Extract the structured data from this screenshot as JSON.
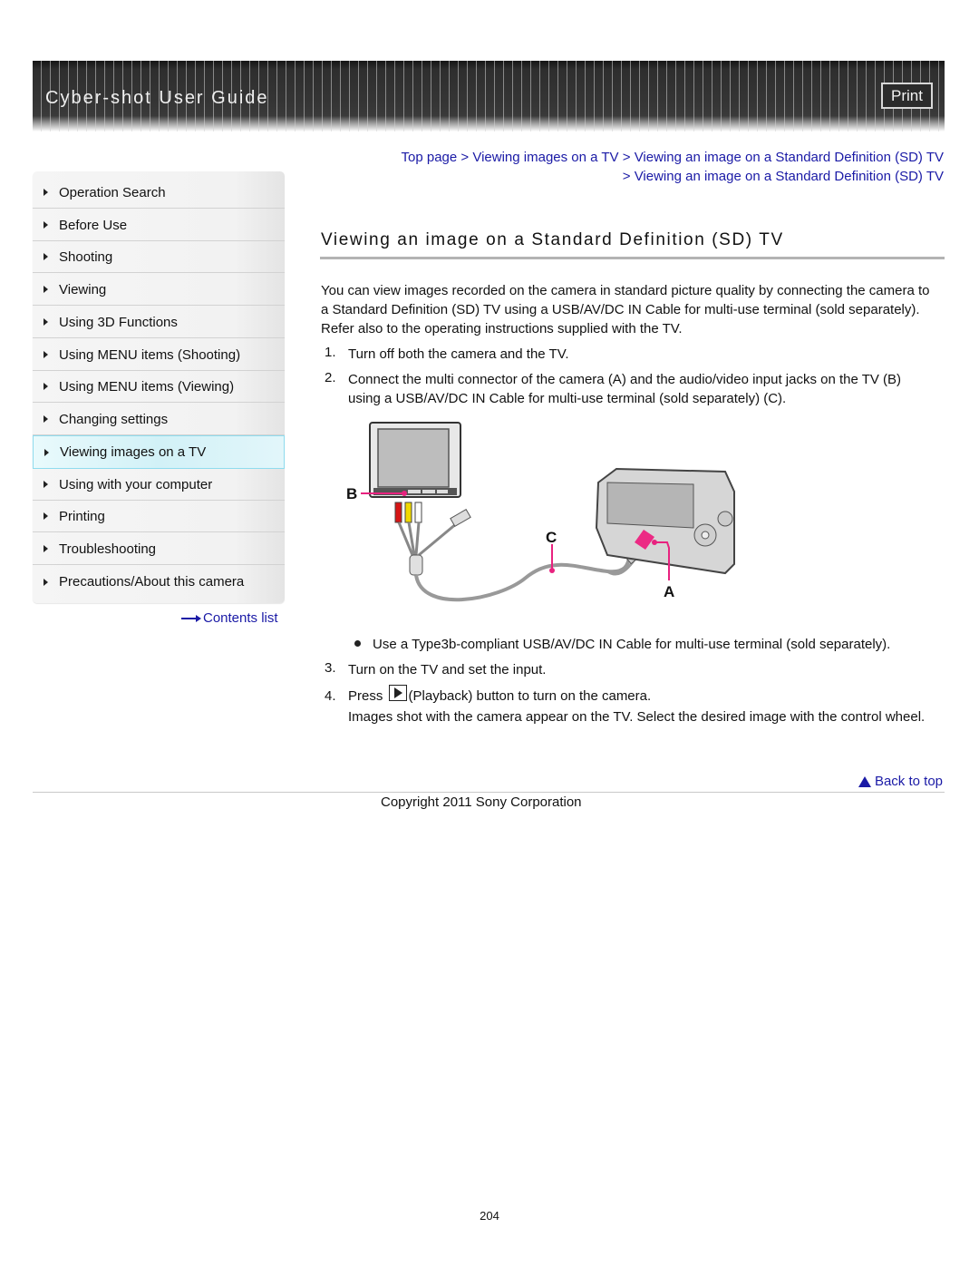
{
  "header": {
    "title": "Cyber-shot User Guide",
    "print_label": "Print"
  },
  "sidebar": {
    "items": [
      {
        "label": "Operation Search",
        "active": false
      },
      {
        "label": "Before Use",
        "active": false
      },
      {
        "label": "Shooting",
        "active": false
      },
      {
        "label": "Viewing",
        "active": false
      },
      {
        "label": "Using 3D Functions",
        "active": false
      },
      {
        "label": "Using MENU items (Shooting)",
        "active": false
      },
      {
        "label": "Using MENU items (Viewing)",
        "active": false
      },
      {
        "label": "Changing settings",
        "active": false
      },
      {
        "label": "Viewing images on a TV",
        "active": true
      },
      {
        "label": "Using with your computer",
        "active": false
      },
      {
        "label": "Printing",
        "active": false
      },
      {
        "label": "Troubleshooting",
        "active": false
      },
      {
        "label": "Precautions/About this camera",
        "active": false
      }
    ],
    "contents_link": "Contents list"
  },
  "breadcrumb": {
    "items": [
      "Top page",
      "Viewing images on a TV",
      "Viewing an image on a Standard Definition (SD) TV",
      "Viewing an image on a Standard Definition (SD) TV"
    ],
    "separator": " > "
  },
  "main": {
    "title": "Viewing an image on a Standard Definition (SD) TV",
    "intro": "You can view images recorded on the camera in standard picture quality by connecting the camera to a Standard Definition (SD) TV using a USB/AV/DC IN Cable for multi-use terminal (sold separately). Refer also to the operating instructions supplied with the TV.",
    "steps": [
      {
        "num": "1.",
        "text": "Turn off both the camera and the TV."
      },
      {
        "num": "2.",
        "text": "Connect the multi connector of the camera (A) and the audio/video input jacks on the TV (B) using a USB/AV/DC IN Cable for multi-use terminal (sold separately) (C)."
      },
      {
        "num": "3.",
        "text": "Turn on the TV and set the input."
      },
      {
        "num": "4.",
        "text_before": "Press",
        "text_after": "(Playback) button to turn on the camera.",
        "note": "Images shot with the camera appear on the TV. Select the desired image with the control wheel."
      }
    ],
    "bullet": "Use a Type3b-compliant USB/AV/DC IN Cable for multi-use terminal (sold separately).",
    "diagram": {
      "labels": {
        "tv": "B",
        "cable": "C",
        "camera": "A"
      },
      "accent_color": "#e8227f"
    }
  },
  "footer": {
    "back_to_top": "Back to top",
    "copyright": "Copyright 2011 Sony Corporation",
    "page_number": "204"
  }
}
